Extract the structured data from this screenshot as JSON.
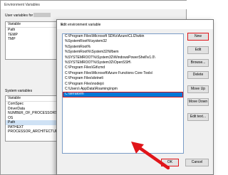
{
  "back_window": {
    "title": "Environment Variables",
    "user_section_label": "User variables for",
    "user_list": {
      "header": "Variable",
      "rows": [
        "Path",
        "TEMP",
        "TMP"
      ]
    },
    "system_section_label": "System variables",
    "system_list": {
      "header": "Variable",
      "rows": [
        "ComSpec",
        "DriverData",
        "NUMBER_OF_PROCESSORS",
        "OS",
        "Path",
        "PATHEXT",
        "PROCESSOR_ARCHITECTURE"
      ],
      "selected": "Path"
    }
  },
  "dialog": {
    "title": "Edit environment variable",
    "close_glyph": "✕",
    "paths": [
      "C:\\Program Files\\Microsoft SDKs\\Azure\\CLI2\\wbin",
      "%SystemRoot%\\system32",
      "%SystemRoot%",
      "%SystemRoot%\\System32\\Wbem",
      "%SYSTEMROOT%\\System32\\WindowsPowerShell\\v1.0\\",
      "%SYSTEMROOT%\\System32\\OpenSSH\\",
      "C:\\Program Files\\Git\\cmd",
      "C:\\Program Files\\Microsoft\\Azure Functions Core Tools\\",
      "C:\\Program Files\\dotnet\\",
      "C:\\Program Files\\nodejs\\",
      "C:\\Users\\        AppData\\Roaming\\npm",
      "C:\\terraform"
    ],
    "selected_path": "C:\\terraform",
    "buttons": {
      "new": "New",
      "edit": "Edit",
      "browse": "Browse...",
      "delete": "Delete",
      "move_up": "Move Up",
      "move_down": "Move Down",
      "edit_text": "Edit text...",
      "ok": "OK",
      "cancel": "Cancel"
    },
    "highlight_color": "#e0151a",
    "selection_color": "#0078d7"
  }
}
